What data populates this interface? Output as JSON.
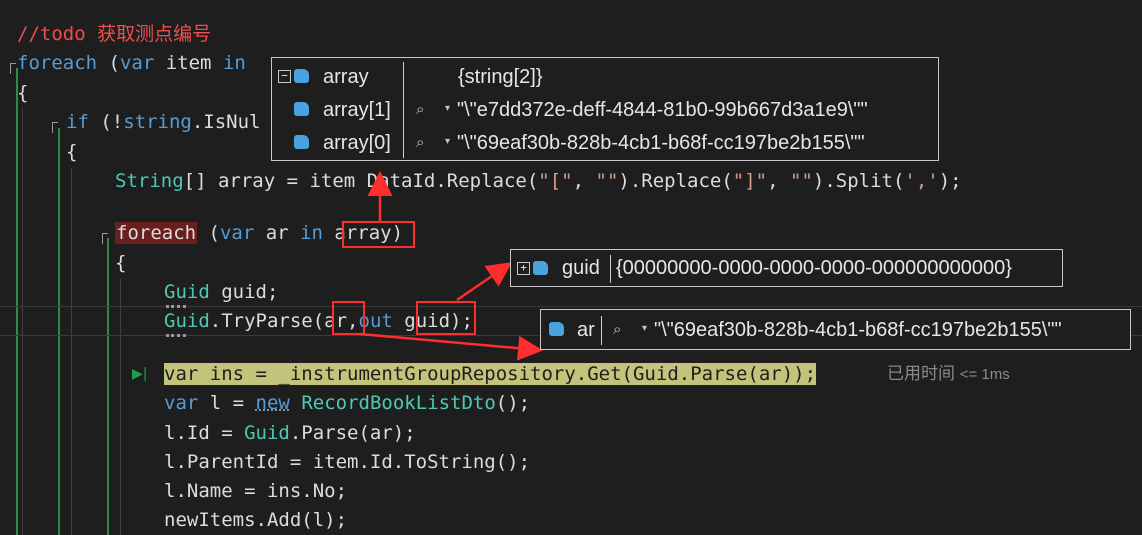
{
  "code": {
    "comment": "//todo 获取测点编号",
    "foreach_outer": {
      "kw": "foreach",
      "open": " (",
      "var": "var",
      "item": " item ",
      "in": "in",
      "rest": " it..."
    },
    "brace_open": "{",
    "if_line": {
      "kw": "if",
      "rest_a": " (!",
      "type": "string",
      "rest_b": ".IsNul"
    },
    "brace_open_2": "{",
    "array_line": {
      "type": "String",
      "rest_a": "[] array = item",
      "rest_b": "DataId.Replace(",
      "s1": "\"[\"",
      "c1": ", ",
      "s2": "\"\"",
      "rest_c": ").Replace(",
      "s3": "\"]\"",
      "c2": ", ",
      "s4": "\"\"",
      "rest_d": ").Split(",
      "s5": "','",
      "rest_e": ");"
    },
    "foreach_inner": {
      "kw": "foreach",
      "open": " (",
      "var": "var",
      "ar": " ar ",
      "in": "in",
      "sp": " ",
      "array": "array",
      "close": ")"
    },
    "brace_open_3": "{",
    "guid_decl": {
      "type": "Guid",
      "rest": " guid;"
    },
    "tryparse": {
      "type": "Guid",
      "rest_a": ".TryParse(",
      "ar": "ar",
      "comma": ",",
      "out": "out",
      "guid": " guid",
      "rest_b": ");"
    },
    "exec_line": "var ins = _instrumentGroupRepository.Get(Guid.Parse(ar));",
    "elapsed_label": "已用时间",
    "elapsed_value": "<= 1ms",
    "recordbook": {
      "var": "var",
      "rest_a": " l = ",
      "new": "new",
      "sp": " ",
      "type": "RecordBookListDto",
      "rest_b": "();"
    },
    "lid": {
      "rest_a": "l.Id = ",
      "type": "Guid",
      "rest_b": ".Parse(ar);"
    },
    "lparent": "l.ParentId = item.Id.ToString();",
    "lname": "l.Name = ins.No;",
    "newitems": "newItems.Add(l);"
  },
  "tooltips": {
    "array": {
      "name": "array",
      "value": "{string[2]}",
      "items": [
        {
          "name": "array[1]",
          "value": "\"\\\"e7dd372e-deff-4844-81b0-99b667d3a1e9\\\"\""
        },
        {
          "name": "array[0]",
          "value": "\"\\\"69eaf30b-828b-4cb1-b68f-cc197be2b155\\\"\""
        }
      ]
    },
    "guid": {
      "name": "guid",
      "value": "{00000000-0000-0000-0000-000000000000}"
    },
    "ar": {
      "name": "ar",
      "value": "\"\\\"69eaf30b-828b-4cb1-b68f-cc197be2b155\\\"\""
    }
  },
  "icons": {
    "expander_collapse": "minus-box-icon",
    "expander_expand": "plus-box-icon",
    "variable": "local-variable-cube-icon",
    "visualizer": "magnifier-icon",
    "dropdown": "triangle-down-icon",
    "exec_pointer": "next-statement-arrow-icon"
  },
  "colors": {
    "background": "#1e1e1e",
    "keyword": "#569cd6",
    "type": "#4ec9b0",
    "string": "#d69d85",
    "comment": "#f24c4c",
    "exec_highlight": "#c4c37b",
    "annotation_red": "#ff2d2d"
  },
  "glyphs": {
    "minus": "−",
    "plus": "+",
    "mag": "⌕",
    "tri": "▾",
    "exec": "▶|"
  }
}
